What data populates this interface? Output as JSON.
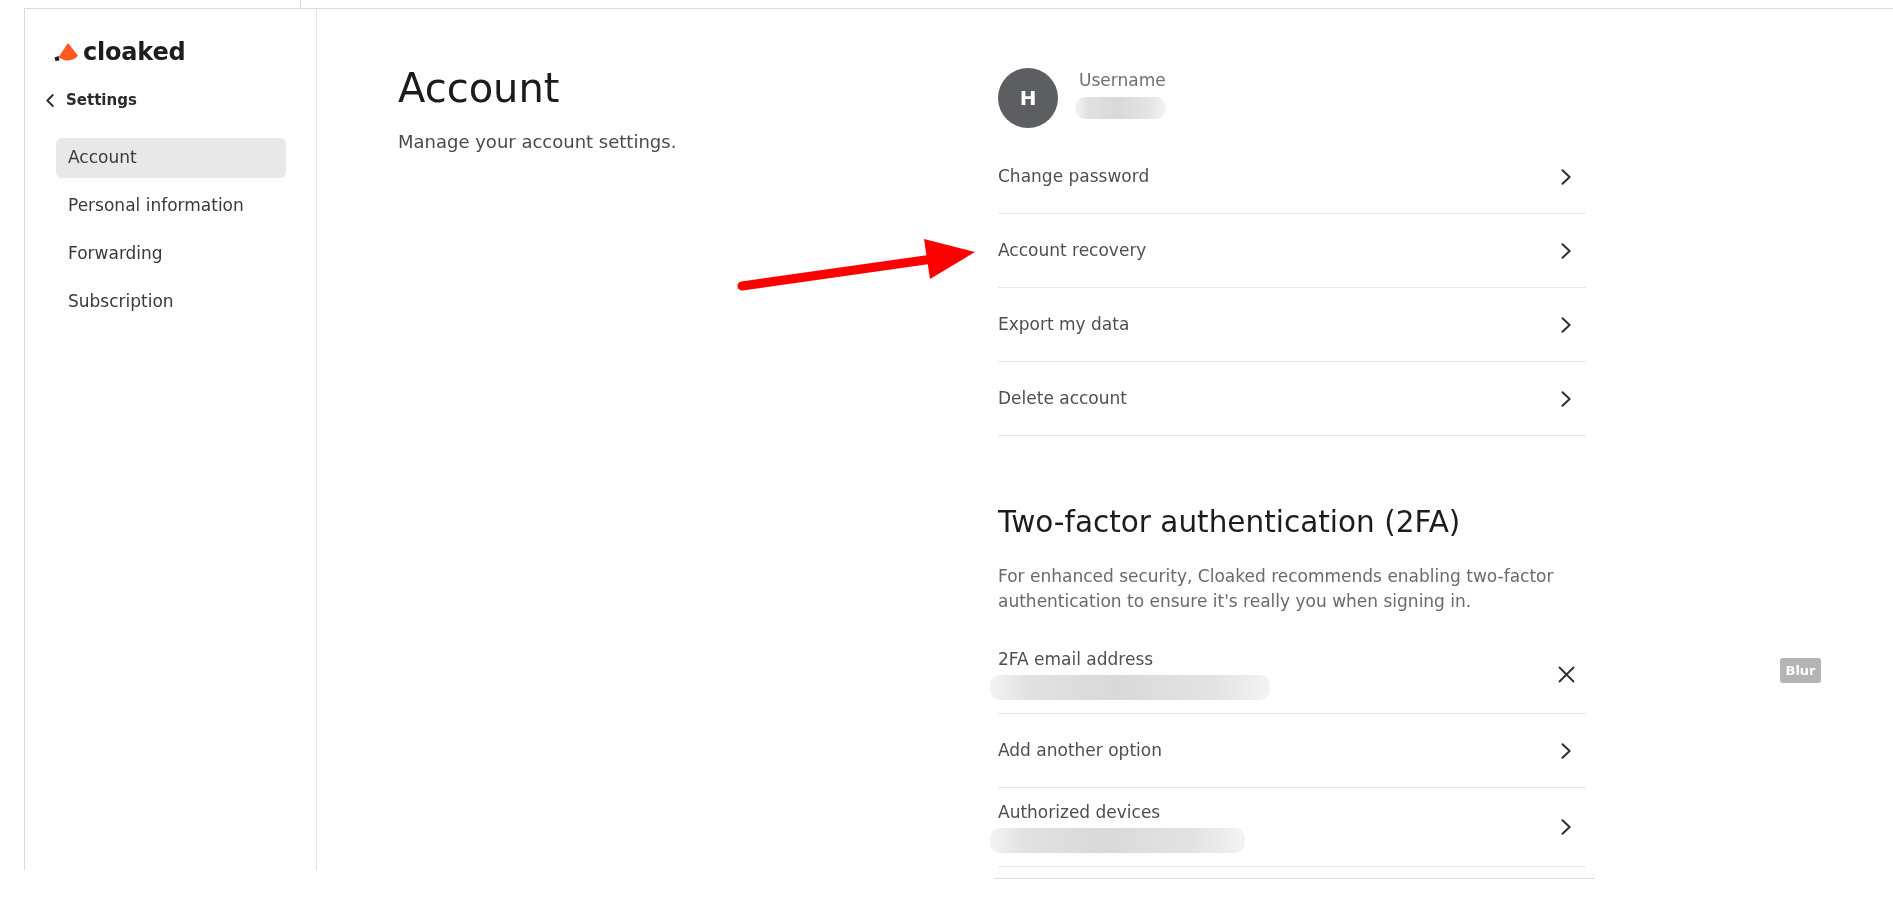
{
  "sidebar": {
    "logo": {
      "text": "cloaked"
    },
    "back": {
      "label": "Settings"
    },
    "items": [
      {
        "label": "Account",
        "selected": true
      },
      {
        "label": "Personal information",
        "selected": false
      },
      {
        "label": "Forwarding",
        "selected": false
      },
      {
        "label": "Subscription",
        "selected": false
      }
    ]
  },
  "header": {
    "title": "Account",
    "subtitle": "Manage your account settings."
  },
  "profile": {
    "initial": "H",
    "label": "Username",
    "redacted": true
  },
  "account_options": [
    {
      "label": "Change password"
    },
    {
      "label": "Account recovery"
    },
    {
      "label": "Export my data"
    },
    {
      "label": "Delete account"
    }
  ],
  "two_factor": {
    "title": "Two-factor authentication (2FA)",
    "description": "For enhanced security, Cloaked recommends enabling two-factor authentication to ensure it's really you when signing in.",
    "options": [
      {
        "label": "2FA email address",
        "kind": "removable",
        "redacted": true
      },
      {
        "label": "Add another option",
        "kind": "link",
        "redacted": false
      },
      {
        "label": "Authorized devices",
        "kind": "link",
        "redacted": true
      }
    ]
  },
  "blur_tag": {
    "label": "Blur"
  }
}
